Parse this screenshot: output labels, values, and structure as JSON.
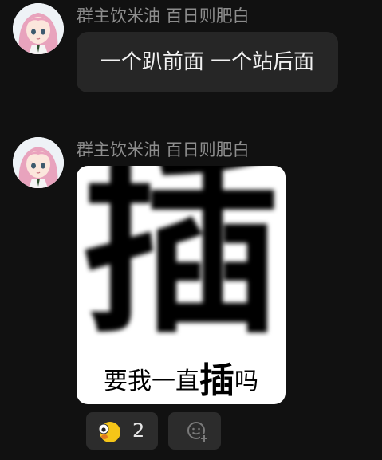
{
  "messages": [
    {
      "sender": "群主饮米油 百日则肥白",
      "text": "一个趴前面 一个站后面",
      "avatar_icon": "anime-girl-avatar"
    },
    {
      "sender": "群主饮米油 百日则肥白",
      "sticker": {
        "big_char": "插",
        "caption_before": "要我一直",
        "caption_emph": "插",
        "caption_after": "吗"
      },
      "avatar_icon": "anime-girl-avatar"
    }
  ],
  "reactions": [
    {
      "icon": "face-emoji-icon",
      "count": "2"
    }
  ],
  "add_reaction_icon": "add-emoji-icon",
  "colors": {
    "background": "#111111",
    "bubble": "#262626",
    "sender_text": "#8d8d8d",
    "message_text": "#f2f2f2",
    "reaction_bg": "#2c2c2c"
  }
}
